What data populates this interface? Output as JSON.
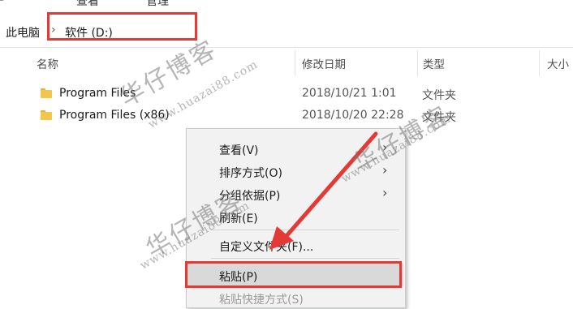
{
  "ribbon": {
    "tab_view": "查看",
    "tab_manage": "管理"
  },
  "breadcrumb": {
    "root": "此电脑",
    "separator": "›",
    "drive": "软件 (D:)"
  },
  "columns": {
    "name": "名称",
    "modified": "修改日期",
    "type": "类型",
    "size": "大小"
  },
  "files": [
    {
      "name": "Program Files",
      "modified": "2018/10/21 1:01",
      "type": "文件夹"
    },
    {
      "name": "Program Files (x86)",
      "modified": "2018/10/20 22:28",
      "type": "文件夹"
    }
  ],
  "context_menu": {
    "view": "查看(V)",
    "sort_by": "排序方式(O)",
    "group_by": "分组依据(P)",
    "refresh": "刷新(E)",
    "customize": "自定义文件夹(F)...",
    "paste": "粘贴(P)",
    "paste_shortcut": "粘贴快捷方式(S)"
  },
  "watermark": {
    "title": "华仔博客",
    "url": "www.huazai88.com"
  },
  "colors": {
    "highlight_red": "#e53935",
    "folder_yellow": "#f3c54d",
    "menu_bg": "#f2f2f2"
  },
  "icons": {
    "folder": "folder-icon",
    "submenu": "chevron-right-icon",
    "breadcrumb_sep": "chevron-right-icon"
  }
}
